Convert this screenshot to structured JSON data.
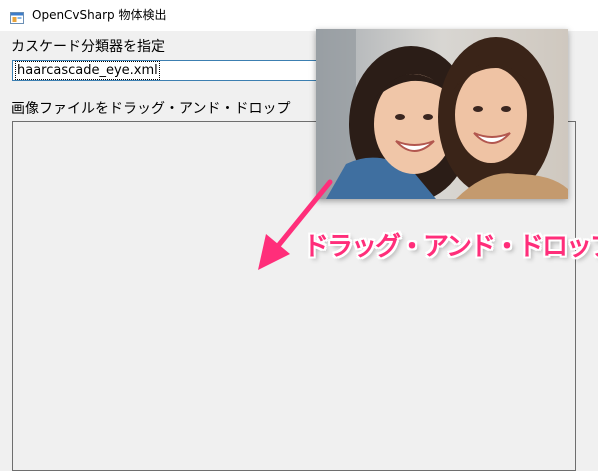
{
  "window": {
    "title": "OpenCvSharp 物体検出",
    "icon": "app-window-icon"
  },
  "form": {
    "cascade_label": "カスケード分類器を指定",
    "cascade_value": "haarcascade_eye.xml",
    "drop_label": "画像ファイルをドラッグ・アンド・ドロップ"
  },
  "overlay": {
    "photo": "two-women-smiling-photo",
    "caption": "ドラッグ・アンド・ドロップ",
    "arrow": "drag-arrow-icon",
    "accent_color": "#ff2e7a"
  }
}
